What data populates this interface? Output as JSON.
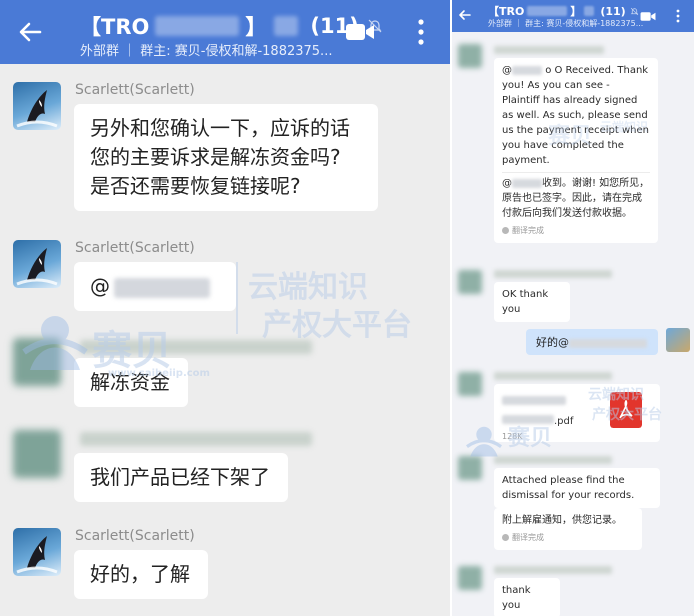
{
  "left": {
    "header": {
      "title_prefix": "【TRO",
      "title_bracket": "】",
      "member_count": "(11)",
      "subtitle": "外部群 ｜ 群主: 赛贝-侵权和解-1882375..."
    },
    "messages": [
      {
        "sender": "Scarlett(Scarlett)",
        "text": "另外和您确认一下，应诉的话\n您的主要诉求是解冻资金吗?\n是否还需要恢复链接呢?"
      },
      {
        "sender": "Scarlett(Scarlett)",
        "text": "@"
      },
      {
        "sender": "",
        "text": "解冻资金"
      },
      {
        "sender": "",
        "text": "我们产品已经下架了"
      },
      {
        "sender": "Scarlett(Scarlett)",
        "text": "好的，了解"
      }
    ]
  },
  "right": {
    "header": {
      "title_prefix": "【TRO",
      "title_bracket": "】",
      "member_count": "(11)",
      "subtitle": "外部群 ｜ 群主: 赛贝-侵权和解-1882375..."
    },
    "msg1": {
      "at": "@",
      "text_rest": "o O Received. Thank you! As you can see - Plaintiff has already signed as well. As such, please send us the payment receipt when you have completed the payment.",
      "translation_at": "@",
      "translation_rest": "收到。谢谢! 如您所见，原告也已签字。因此，请在完成付款后向我们发送付款收据。",
      "translated_label": "翻译完成"
    },
    "msg2": {
      "text": "OK thank you"
    },
    "msg3": {
      "text": "好的@"
    },
    "file": {
      "ext": ".pdf",
      "size": "128K"
    },
    "msg4": {
      "text": "Attached please find the dismissal for your records.",
      "translation": "附上解雇通知，供您记录。",
      "translated_label": "翻译完成"
    },
    "msg5": {
      "text": "thank you"
    }
  },
  "watermark": {
    "brand": "赛贝",
    "slogan_line1": "云端知识",
    "slogan_line2": "产权大平台",
    "url": "www.saibeiip.com"
  }
}
